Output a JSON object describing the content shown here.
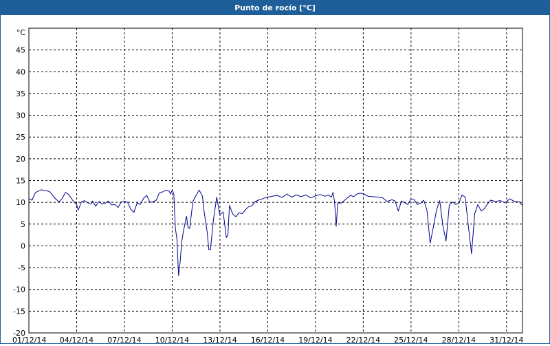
{
  "window": {
    "title": "Punto de rocío [°C]"
  },
  "colors": {
    "title_bar": "#1f5f99",
    "series": "#00008b",
    "grid": "#000000",
    "background": "#ffffff"
  },
  "chart_data": {
    "type": "line",
    "title": "Punto de rocío [°C]",
    "ylabel": "°C",
    "xlabel": "",
    "ylim": [
      -20,
      50
    ],
    "yticks": [
      -20,
      -15,
      -10,
      -5,
      0,
      5,
      10,
      15,
      20,
      25,
      30,
      35,
      40,
      45
    ],
    "xlim_day": [
      1,
      32.0
    ],
    "xticks": [
      {
        "day": 1,
        "label": "01/12/14"
      },
      {
        "day": 4,
        "label": "04/12/14"
      },
      {
        "day": 7,
        "label": "07/12/14"
      },
      {
        "day": 10,
        "label": "10/12/14"
      },
      {
        "day": 13,
        "label": "13/12/14"
      },
      {
        "day": 16,
        "label": "16/12/14"
      },
      {
        "day": 19,
        "label": "19/12/14"
      },
      {
        "day": 22,
        "label": "22/12/14"
      },
      {
        "day": 25,
        "label": "25/12/14"
      },
      {
        "day": 28,
        "label": "28/12/14"
      },
      {
        "day": 31,
        "label": "31/12/14"
      }
    ],
    "grid": true,
    "series": [
      {
        "name": "",
        "x_day": [
          1.0,
          1.2,
          1.4,
          1.6,
          1.8,
          2.0,
          2.3,
          2.6,
          2.9,
          3.1,
          3.3,
          3.5,
          3.8,
          4.0,
          4.1,
          4.3,
          4.5,
          4.7,
          4.9,
          5.0,
          5.2,
          5.4,
          5.6,
          5.8,
          6.0,
          6.2,
          6.4,
          6.6,
          6.8,
          7.0,
          7.2,
          7.4,
          7.6,
          7.8,
          8.0,
          8.2,
          8.4,
          8.6,
          8.8,
          9.0,
          9.2,
          9.4,
          9.6,
          9.8,
          9.9,
          10.0,
          10.1,
          10.2,
          10.3,
          10.4,
          10.5,
          10.6,
          10.7,
          10.9,
          11.0,
          11.1,
          11.3,
          11.5,
          11.7,
          11.9,
          12.0,
          12.2,
          12.3,
          12.4,
          12.6,
          12.8,
          12.9,
          13.0,
          13.2,
          13.4,
          13.5,
          13.6,
          13.8,
          14.0,
          14.2,
          14.4,
          14.6,
          14.8,
          15.0,
          15.2,
          15.4,
          15.6,
          15.8,
          16.0,
          16.3,
          16.6,
          16.9,
          17.2,
          17.5,
          17.8,
          18.1,
          18.4,
          18.7,
          19.0,
          19.3,
          19.6,
          19.8,
          20.0,
          20.1,
          20.2,
          20.3,
          20.4,
          20.6,
          20.8,
          21.0,
          21.2,
          21.4,
          21.6,
          21.8,
          22.0,
          22.3,
          22.6,
          22.9,
          23.2,
          23.5,
          23.8,
          24.0,
          24.2,
          24.4,
          24.6,
          24.8,
          25.0,
          25.2,
          25.4,
          25.6,
          25.8,
          26.0,
          26.2,
          26.4,
          26.6,
          26.8,
          27.0,
          27.2,
          27.4,
          27.6,
          27.8,
          28.0,
          28.2,
          28.4,
          28.6,
          28.8,
          29.0,
          29.2,
          29.4,
          29.6,
          29.8,
          30.0,
          30.3,
          30.6,
          30.9,
          31.2,
          31.5,
          31.8,
          32.0
        ],
        "y": [
          10.8,
          10.5,
          12.2,
          12.6,
          12.9,
          12.7,
          12.5,
          11.1,
          10.1,
          10.9,
          12.3,
          11.8,
          10.2,
          9.5,
          8.2,
          10.1,
          10.4,
          9.9,
          9.6,
          10.3,
          9.1,
          10.2,
          9.6,
          9.8,
          10.3,
          9.4,
          9.5,
          8.8,
          10.1,
          10.2,
          10.0,
          8.4,
          7.7,
          9.9,
          9.5,
          10.9,
          11.6,
          10.0,
          10.1,
          10.5,
          12.2,
          12.4,
          12.8,
          12.6,
          11.9,
          12.8,
          12.0,
          4.0,
          1.5,
          -6.8,
          -3.8,
          0.9,
          3.3,
          6.8,
          4.2,
          4.0,
          10.2,
          11.6,
          12.8,
          11.4,
          8.0,
          3.1,
          -0.8,
          -0.9,
          6.3,
          11.2,
          9.0,
          7.2,
          7.8,
          1.9,
          2.5,
          9.3,
          7.3,
          6.7,
          7.6,
          7.4,
          8.3,
          9.0,
          9.2,
          10.1,
          10.5,
          10.7,
          11.0,
          11.2,
          11.4,
          11.6,
          11.1,
          11.9,
          11.2,
          11.7,
          11.3,
          11.7,
          11.0,
          11.5,
          11.8,
          11.4,
          11.7,
          11.2,
          12.3,
          10.0,
          4.5,
          9.9,
          9.8,
          10.4,
          11.0,
          11.6,
          11.3,
          11.9,
          12.1,
          12.0,
          11.4,
          11.3,
          11.2,
          11.1,
          10.2,
          10.6,
          10.3,
          8.0,
          10.3,
          9.9,
          9.5,
          10.8,
          10.6,
          9.5,
          9.8,
          10.5,
          8.2,
          0.6,
          4.3,
          8.2,
          10.4,
          4.6,
          1.1,
          9.3,
          10.1,
          9.5,
          9.8,
          11.7,
          11.2,
          4.5,
          -1.8,
          7.4,
          9.5,
          8.0,
          8.5,
          9.6,
          10.5,
          10.2,
          10.4,
          9.9,
          10.8,
          10.2,
          10.1,
          9.3,
          8.5
        ]
      }
    ]
  }
}
